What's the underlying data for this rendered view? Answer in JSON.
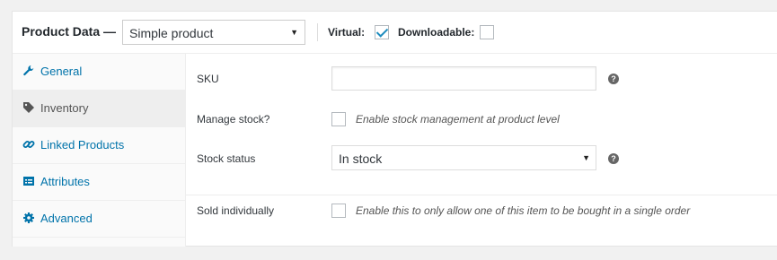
{
  "header": {
    "title": "Product Data —",
    "product_type": "Simple product",
    "virtual_label": "Virtual:",
    "virtual_checked": true,
    "downloadable_label": "Downloadable:",
    "downloadable_checked": false
  },
  "tabs": [
    {
      "label": "General",
      "icon": "wrench-icon",
      "active": false
    },
    {
      "label": "Inventory",
      "icon": "tag-icon",
      "active": true
    },
    {
      "label": "Linked Products",
      "icon": "link-icon",
      "active": false
    },
    {
      "label": "Attributes",
      "icon": "table-icon",
      "active": false
    },
    {
      "label": "Advanced",
      "icon": "gear-icon",
      "active": false
    }
  ],
  "fields": {
    "sku": {
      "label": "SKU",
      "value": ""
    },
    "manage_stock": {
      "label": "Manage stock?",
      "description": "Enable stock management at product level",
      "checked": false
    },
    "stock_status": {
      "label": "Stock status",
      "value": "In stock"
    },
    "sold_individually": {
      "label": "Sold individually",
      "description": "Enable this to only allow one of this item to be bought in a single order",
      "checked": false
    }
  },
  "colors": {
    "link": "#0073aa",
    "accent": "#1e8cbe"
  }
}
